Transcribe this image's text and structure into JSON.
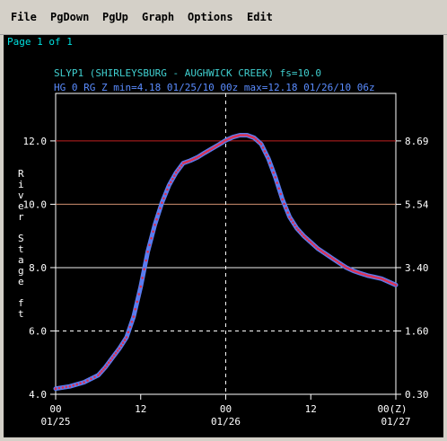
{
  "menu": [
    {
      "label": "File"
    },
    {
      "label": "PgDown"
    },
    {
      "label": "PgUp"
    },
    {
      "label": "Graph"
    },
    {
      "label": "Options"
    },
    {
      "label": "Edit"
    }
  ],
  "page_label": "Page 1 of 1",
  "colors": {
    "background": "#000000",
    "menubar": "#d4d0c8",
    "page_label": "#00e0e0",
    "title_line1": "#40d0d0",
    "title_line2": "#5a8cff",
    "series_line": "#5a7cf0",
    "series_points": "#e03050",
    "ref_line_action": "#c02020",
    "ref_line_flood": "#d09070",
    "ref_line_other": "#f0f0f0",
    "frame": "#ffffff",
    "text": "#ffffff"
  },
  "chart_data": {
    "type": "line",
    "title": "SLYP1 (SHIRLEYSBURG - AUGHWICK CREEK) fs=10.0",
    "subtitle": "HG 0 RG Z min=4.18 01/25/10 00z max=12.18 01/26/10 06z",
    "ylabel": "River Stage ft",
    "ylim": [
      4.0,
      13.5
    ],
    "y_ticks": [
      "4.0",
      "6.0",
      "8.0",
      "10.0",
      "12.0"
    ],
    "y2_ticks": [
      "0.30",
      "1.60",
      "3.40",
      "5.54",
      "8.69"
    ],
    "x_tick_labels": [
      {
        "top": "00",
        "bottom": "01/25"
      },
      {
        "top": "12",
        "bottom": ""
      },
      {
        "top": "00",
        "bottom": "01/26"
      },
      {
        "top": "12",
        "bottom": ""
      },
      {
        "top": "00(Z)",
        "bottom": "01/27"
      }
    ],
    "xlim_hours": [
      0,
      48
    ],
    "grid": "dashed at 00Z 01/26 and stage 6.0",
    "reference_lines": [
      {
        "stage": 12.0,
        "kind": "action"
      },
      {
        "stage": 10.0,
        "kind": "flood"
      },
      {
        "stage": 8.0,
        "kind": "other"
      },
      {
        "stage": 6.0,
        "kind": "dashed"
      }
    ],
    "series": [
      {
        "x_hours": [
          0,
          2,
          4,
          6,
          7,
          8,
          9,
          10,
          11,
          12,
          13,
          14,
          15,
          16,
          17,
          18,
          19,
          20,
          21,
          22,
          23,
          24,
          25,
          26,
          27,
          28,
          29,
          30,
          31,
          32,
          33,
          34,
          35,
          36,
          37,
          38,
          39,
          40,
          41,
          42,
          43,
          44,
          45,
          46,
          47,
          48
        ],
        "stage_ft": [
          4.18,
          4.25,
          4.38,
          4.6,
          4.85,
          5.15,
          5.45,
          5.8,
          6.45,
          7.4,
          8.5,
          9.35,
          10.05,
          10.6,
          11.0,
          11.3,
          11.38,
          11.48,
          11.62,
          11.75,
          11.88,
          12.02,
          12.12,
          12.18,
          12.18,
          12.1,
          11.9,
          11.45,
          10.85,
          10.15,
          9.6,
          9.25,
          9.0,
          8.8,
          8.6,
          8.45,
          8.3,
          8.15,
          8.0,
          7.9,
          7.82,
          7.75,
          7.7,
          7.65,
          7.55,
          7.45
        ]
      }
    ]
  }
}
